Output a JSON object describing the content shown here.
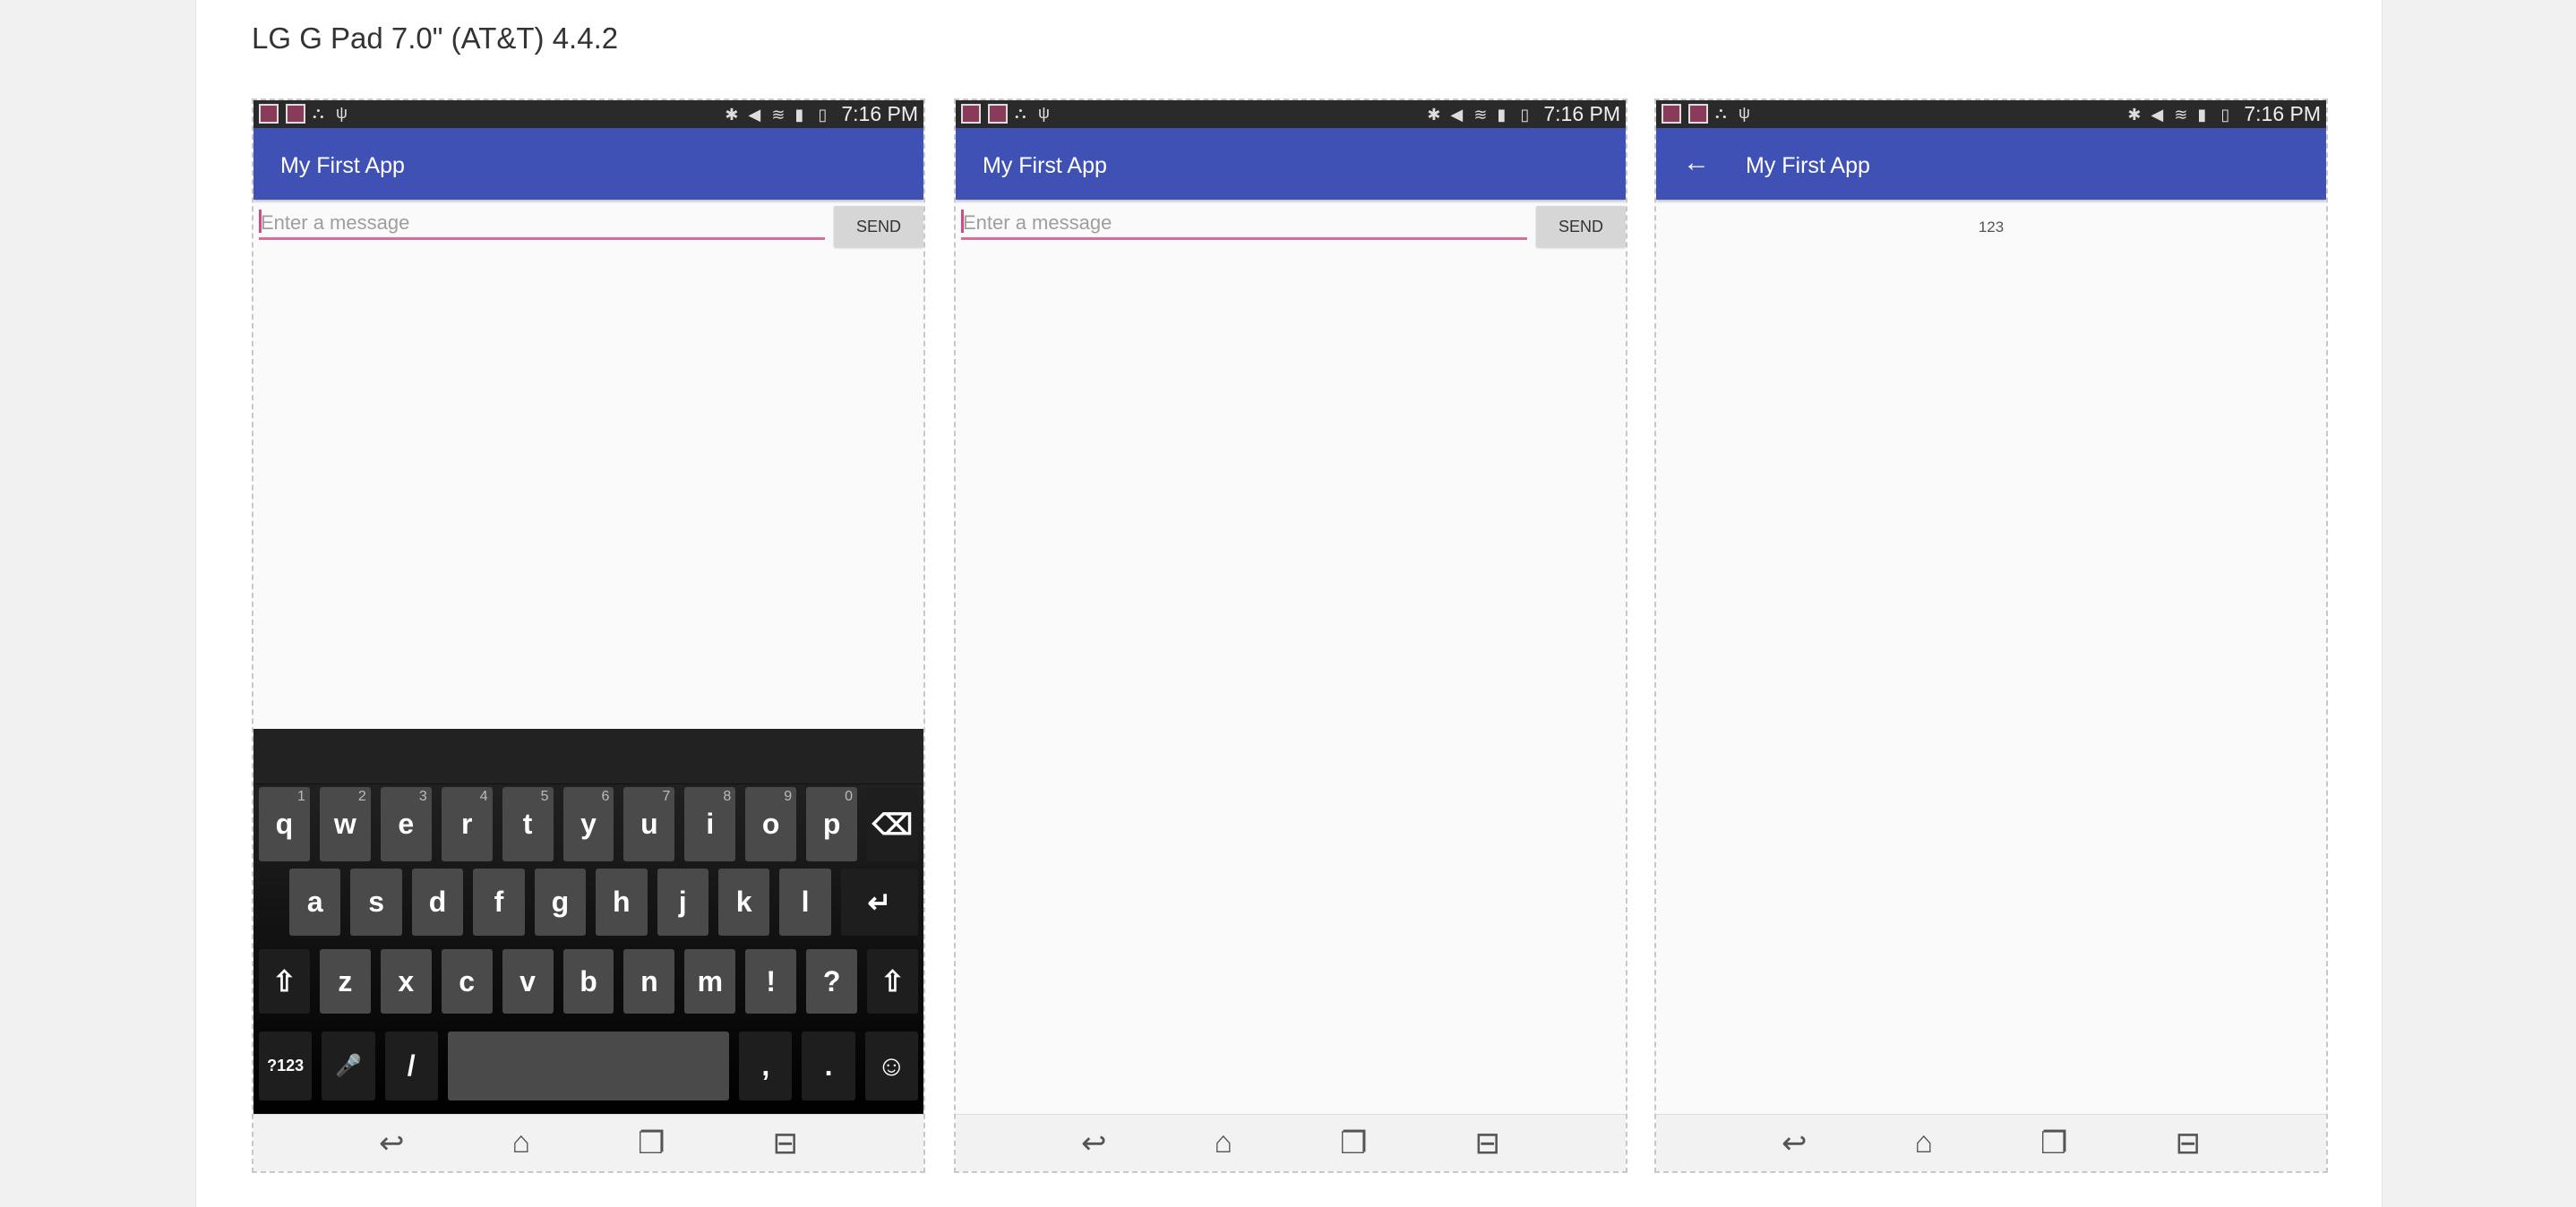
{
  "page": {
    "title": "LG G Pad 7.0\" (AT&T) 4.4.2"
  },
  "status": {
    "time": "7:16 PM"
  },
  "app": {
    "title": "My First App"
  },
  "compose": {
    "placeholder": "Enter a message",
    "send": "SEND"
  },
  "result": {
    "message": "123"
  },
  "colors": {
    "appbar": "#3f51b5",
    "accent": "#d96b9d"
  },
  "keyboard": {
    "row1": [
      [
        "q",
        "1"
      ],
      [
        "w",
        "2"
      ],
      [
        "e",
        "3"
      ],
      [
        "r",
        "4"
      ],
      [
        "t",
        "5"
      ],
      [
        "y",
        "6"
      ],
      [
        "u",
        "7"
      ],
      [
        "i",
        "8"
      ],
      [
        "o",
        "9"
      ],
      [
        "p",
        "0"
      ]
    ],
    "row2": [
      "a",
      "s",
      "d",
      "f",
      "g",
      "h",
      "j",
      "k",
      "l"
    ],
    "row3": [
      "z",
      "x",
      "c",
      "v",
      "b",
      "n",
      "m",
      "!",
      "?"
    ],
    "symbols": "?123",
    "slash": "/",
    "comma": ",",
    "period": "."
  },
  "nav": {
    "icons": [
      "back-icon",
      "home-icon",
      "recents-icon",
      "menu-icon"
    ]
  }
}
